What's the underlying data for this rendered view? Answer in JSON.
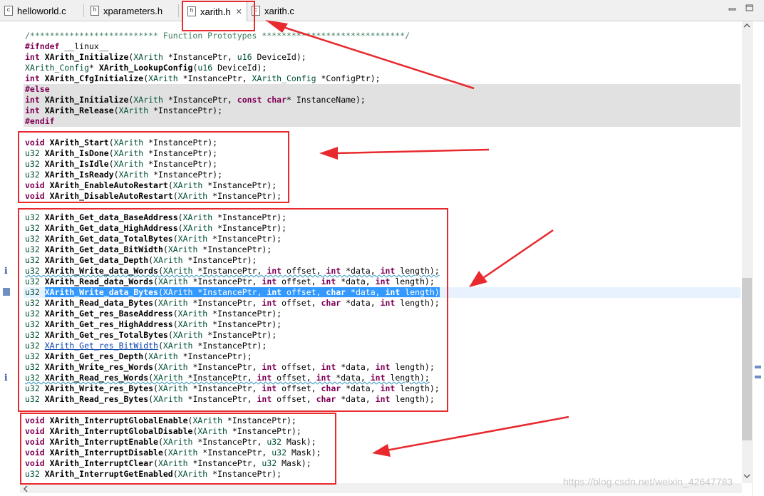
{
  "tabs": [
    {
      "label": "helloworld.c",
      "icon": "c-file-icon",
      "active": false
    },
    {
      "label": "xparameters.h",
      "icon": "h-file-icon",
      "active": false
    },
    {
      "label": "xarith.h",
      "icon": "h-file-icon",
      "active": true
    },
    {
      "label": "xarith.c",
      "icon": "c-file-icon",
      "active": false
    }
  ],
  "code": {
    "l01": "/************************** Function Prototypes *****************************/",
    "l02a": "#ifndef",
    "l02b": " __linux__",
    "l03": [
      "int",
      " ",
      "XArith_Initialize",
      "(",
      "XArith",
      " *InstancePtr, ",
      "u16",
      " DeviceId);"
    ],
    "l04": [
      "XArith_Config",
      "* ",
      "XArith_LookupConfig",
      "(",
      "u16",
      " DeviceId);"
    ],
    "l05": [
      "int",
      " ",
      "XArith_CfgInitialize",
      "(",
      "XArith",
      " *InstancePtr, ",
      "XArith_Config",
      " *ConfigPtr);"
    ],
    "l06": "#else",
    "l07": [
      "int",
      " ",
      "XArith_Initialize",
      "(",
      "XArith",
      " *InstancePtr, ",
      "const",
      " ",
      "char",
      "* InstanceName);"
    ],
    "l08": [
      "int",
      " ",
      "XArith_Release",
      "(",
      "XArith",
      " *InstancePtr);"
    ],
    "l09": "#endif",
    "l10": "",
    "l11": [
      "void",
      " ",
      "XArith_Start",
      "(",
      "XArith",
      " *InstancePtr);"
    ],
    "l12": [
      "u32",
      " ",
      "XArith_IsDone",
      "(",
      "XArith",
      " *InstancePtr);"
    ],
    "l13": [
      "u32",
      " ",
      "XArith_IsIdle",
      "(",
      "XArith",
      " *InstancePtr);"
    ],
    "l14": [
      "u32",
      " ",
      "XArith_IsReady",
      "(",
      "XArith",
      " *InstancePtr);"
    ],
    "l15": [
      "void",
      " ",
      "XArith_EnableAutoRestart",
      "(",
      "XArith",
      " *InstancePtr);"
    ],
    "l16": [
      "void",
      " ",
      "XArith_DisableAutoRestart",
      "(",
      "XArith",
      " *InstancePtr);"
    ],
    "l17": "",
    "l18": [
      "u32",
      " ",
      "XArith_Get_data_BaseAddress",
      "(",
      "XArith",
      " *InstancePtr);"
    ],
    "l19": [
      "u32",
      " ",
      "XArith_Get_data_HighAddress",
      "(",
      "XArith",
      " *InstancePtr);"
    ],
    "l20": [
      "u32",
      " ",
      "XArith_Get_data_TotalBytes",
      "(",
      "XArith",
      " *InstancePtr);"
    ],
    "l21": [
      "u32",
      " ",
      "XArith_Get_data_BitWidth",
      "(",
      "XArith",
      " *InstancePtr);"
    ],
    "l22": [
      "u32",
      " ",
      "XArith_Get_data_Depth",
      "(",
      "XArith",
      " *InstancePtr);"
    ],
    "l23": [
      "u32",
      " ",
      "XArith_Write_data_Words",
      "(",
      "XArith",
      " *InstancePtr, ",
      "int",
      " offset, ",
      "int",
      " *data, ",
      "int",
      " length);"
    ],
    "l24": [
      "u32",
      " ",
      "XArith_Read_data_Words",
      "(",
      "XArith",
      " *InstancePtr, ",
      "int",
      " offset, ",
      "int",
      " *data, ",
      "int",
      " length);"
    ],
    "l25": [
      "u32",
      " ",
      "XArith_Write_data_Bytes",
      "(",
      "XArith",
      " *InstancePtr, ",
      "int",
      " offset, ",
      "char",
      " *data, ",
      "int",
      " length)"
    ],
    "l26": [
      "u32",
      " ",
      "XArith_Read_data_Bytes",
      "(",
      "XArith",
      " *InstancePtr, ",
      "int",
      " offset, ",
      "char",
      " *data, ",
      "int",
      " length);"
    ],
    "l27": [
      "u32",
      " ",
      "XArith_Get_res_BaseAddress",
      "(",
      "XArith",
      " *InstancePtr);"
    ],
    "l28": [
      "u32",
      " ",
      "XArith_Get_res_HighAddress",
      "(",
      "XArith",
      " *InstancePtr);"
    ],
    "l29": [
      "u32",
      " ",
      "XArith_Get_res_TotalBytes",
      "(",
      "XArith",
      " *InstancePtr);"
    ],
    "l30": [
      "u32",
      " ",
      "XArith_Get_res_BitWidth",
      "(",
      "XArith",
      " *InstancePtr);"
    ],
    "l31": [
      "u32",
      " ",
      "XArith_Get_res_Depth",
      "(",
      "XArith",
      " *InstancePtr);"
    ],
    "l32": [
      "u32",
      " ",
      "XArith_Write_res_Words",
      "(",
      "XArith",
      " *InstancePtr, ",
      "int",
      " offset, ",
      "int",
      " *data, ",
      "int",
      " length);"
    ],
    "l33": [
      "u32",
      " ",
      "XArith_Read_res_Words",
      "(",
      "XArith",
      " *InstancePtr, ",
      "int",
      " offset, ",
      "int",
      " *data, ",
      "int",
      " length);"
    ],
    "l34": [
      "u32",
      " ",
      "XArith_Write_res_Bytes",
      "(",
      "XArith",
      " *InstancePtr, ",
      "int",
      " offset, ",
      "char",
      " *data, ",
      "int",
      " length);"
    ],
    "l35": [
      "u32",
      " ",
      "XArith_Read_res_Bytes",
      "(",
      "XArith",
      " *InstancePtr, ",
      "int",
      " offset, ",
      "char",
      " *data, ",
      "int",
      " length);"
    ],
    "l36": "",
    "l37": [
      "void",
      " ",
      "XArith_InterruptGlobalEnable",
      "(",
      "XArith",
      " *InstancePtr);"
    ],
    "l38": [
      "void",
      " ",
      "XArith_InterruptGlobalDisable",
      "(",
      "XArith",
      " *InstancePtr);"
    ],
    "l39": [
      "void",
      " ",
      "XArith_InterruptEnable",
      "(",
      "XArith",
      " *InstancePtr, ",
      "u32",
      " Mask);"
    ],
    "l40": [
      "void",
      " ",
      "XArith_InterruptDisable",
      "(",
      "XArith",
      " *InstancePtr, ",
      "u32",
      " Mask);"
    ],
    "l41": [
      "void",
      " ",
      "XArith_InterruptClear",
      "(",
      "XArith",
      " *InstancePtr, ",
      "u32",
      " Mask);"
    ],
    "l42": [
      "u32",
      " ",
      "XArith_InterruptGetEnabled",
      "(",
      "XArith",
      " *InstancePtr);"
    ]
  },
  "gutter": {
    "info_marker": "i"
  },
  "watermark": "https://blog.csdn.net/weixin_42647783",
  "colors": {
    "annotation_red": "#e8292e",
    "selection": "#3399ff",
    "keyword": "#7f0055",
    "type": "#005032",
    "comment": "#3f7f5f"
  }
}
